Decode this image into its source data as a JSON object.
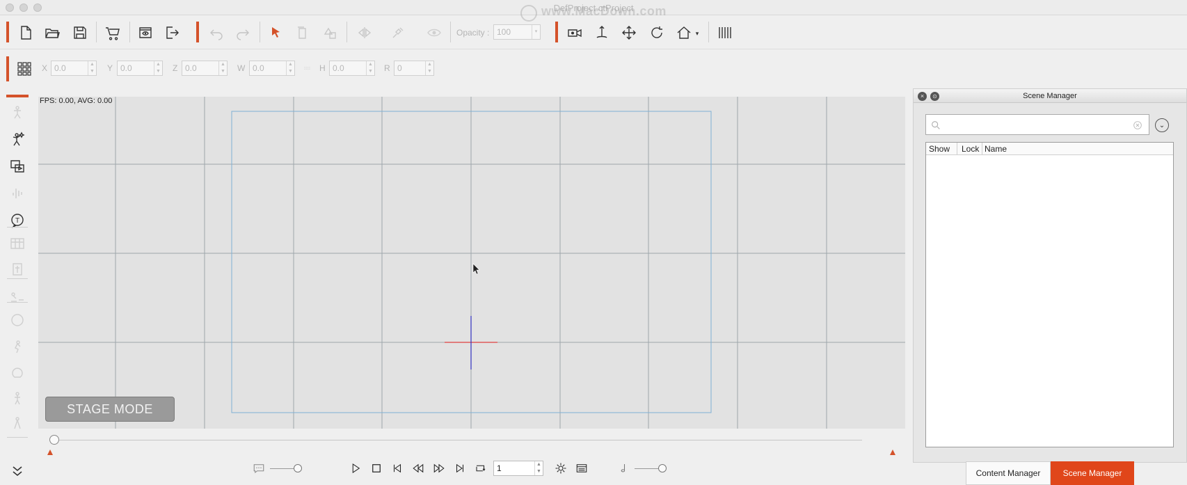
{
  "window": {
    "title": "DefProject.ctProject",
    "watermark": "www.MacDown.com"
  },
  "toolbar": {
    "opacity_label": "Opacity :",
    "opacity_value": "100",
    "icons": [
      "new-file-icon",
      "open-folder-icon",
      "save-icon",
      "cart-icon",
      "preview-icon",
      "export-icon",
      "undo-icon",
      "redo-icon",
      "select-arrow-icon",
      "copy-icon",
      "duplicate-icon",
      "mirror-icon",
      "link-icon",
      "visibility-icon",
      "camera-icon",
      "move-up-icon",
      "move-icon",
      "rotate-icon",
      "home-icon",
      "align-icon"
    ]
  },
  "transform": {
    "x_label": "X",
    "x_value": "0.0",
    "y_label": "Y",
    "y_value": "0.0",
    "z_label": "Z",
    "z_value": "0.0",
    "w_label": "W",
    "w_value": "0.0",
    "h_label": "H",
    "h_value": "0.0",
    "r_label": "R",
    "r_value": "0"
  },
  "viewport": {
    "fps_text": "FPS: 0.00, AVG: 0.00",
    "stage_mode_label": "STAGE MODE"
  },
  "playback": {
    "frame_value": "1"
  },
  "scene_manager": {
    "title": "Scene Manager",
    "search_placeholder": "",
    "columns": [
      "Show",
      "Lock",
      "Name"
    ]
  },
  "bottom_tabs": {
    "content_label": "Content Manager",
    "scene_label": "Scene Manager"
  },
  "colors": {
    "accent": "#d4522a",
    "active_tab": "#e0461a",
    "grid_line": "#9ca4aa",
    "stage_rect": "#7fb0d4",
    "axis_x": "#e04040",
    "axis_y": "#3030c0"
  }
}
